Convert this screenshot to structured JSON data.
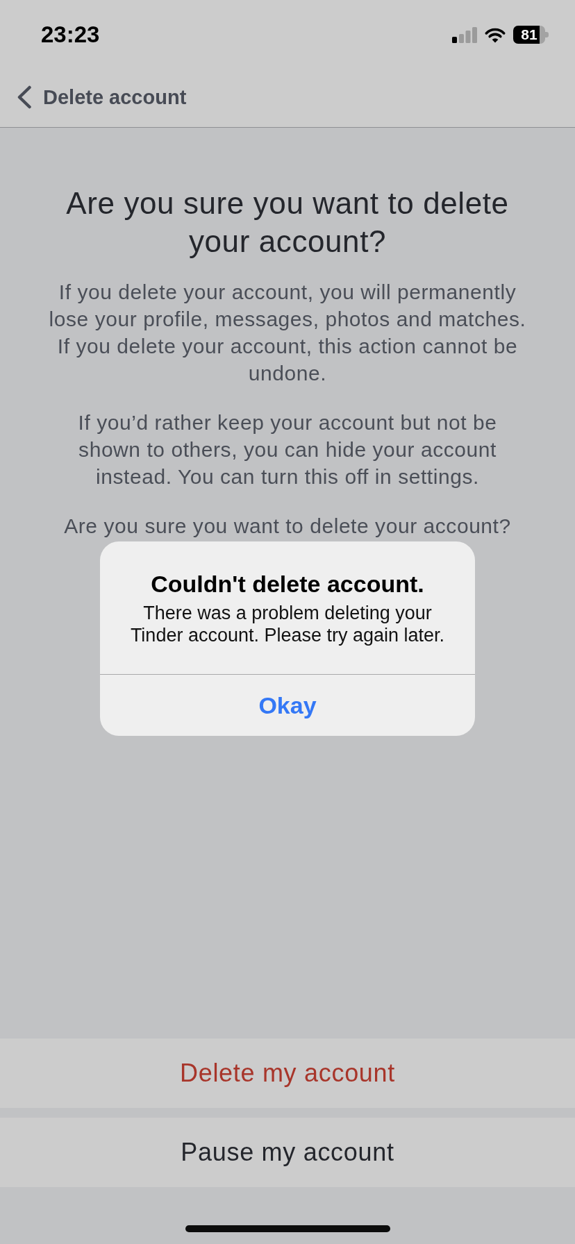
{
  "status_bar": {
    "time": "23:23",
    "battery": "81"
  },
  "nav": {
    "title": "Delete account"
  },
  "content": {
    "title": "Are you sure you want to delete your account?",
    "paragraphs": [
      "If you delete your account, you will permanently lose your profile, messages, photos and matches. If you delete your account, this action cannot be undone.",
      "If you’d rather keep your account but not be shown to others, you can hide your account instead. You can turn this off in settings.",
      "Are you sure you want to delete your account?"
    ]
  },
  "alert": {
    "title": "Couldn't delete account.",
    "message": "There was a problem deleting your Tinder account. Please try again later.",
    "buttons": [
      {
        "label": "Okay"
      }
    ]
  },
  "actions": [
    {
      "label": "Delete my account",
      "kind": "destructive"
    },
    {
      "label": "Pause my account",
      "kind": "default"
    }
  ]
}
